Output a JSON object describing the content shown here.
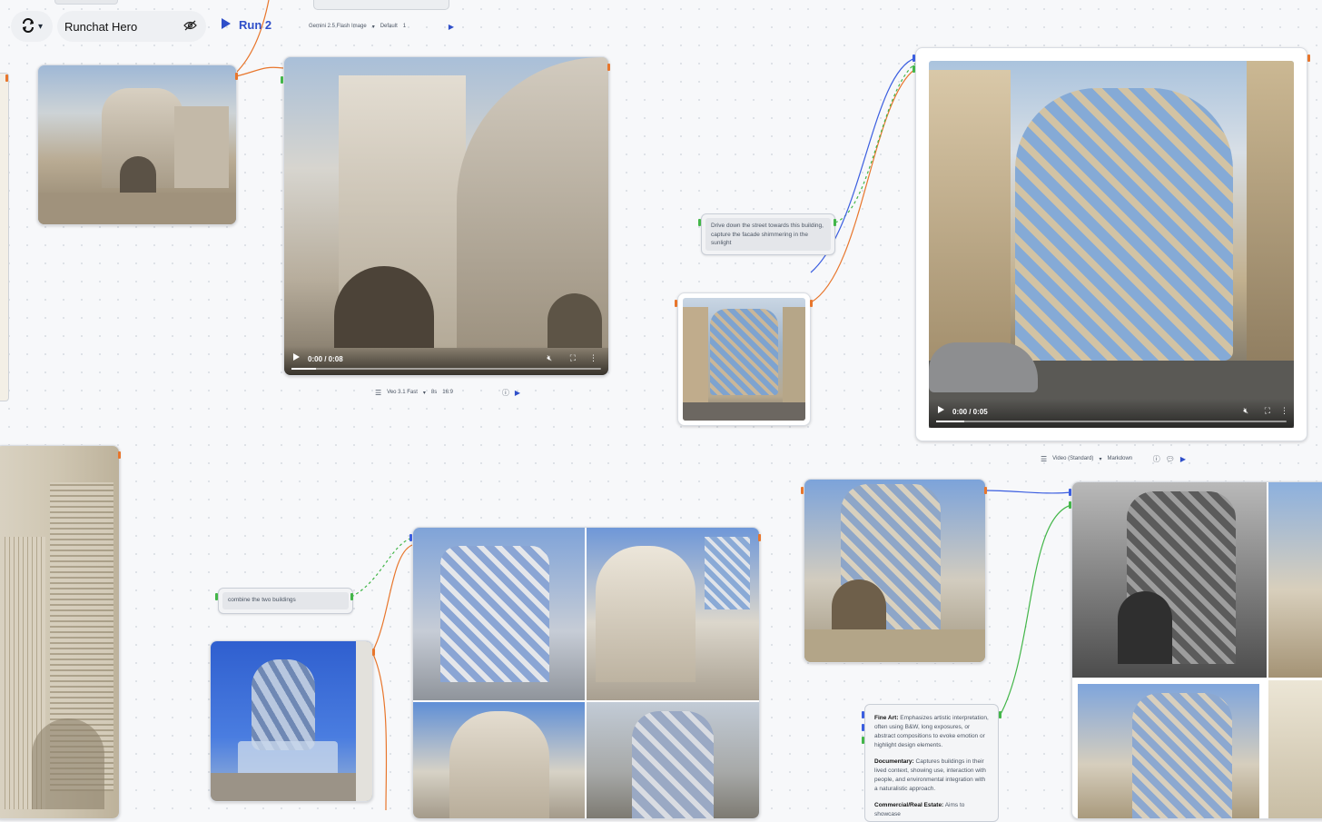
{
  "toolbar": {
    "tool_icon": "rotate-tool-icon",
    "project_name": "Runchat Hero",
    "visibility_icon": "eye-off-icon",
    "run_label": "Run 2"
  },
  "image_params": {
    "model": "Gemini 2.5 Flash Image",
    "preset": "Default",
    "count": "1"
  },
  "video_main": {
    "time": "0:00 / 0:08",
    "params": {
      "model": "Veo 3.1 Fast",
      "duration": "8s",
      "aspect": "16:9"
    }
  },
  "prompt_drive": {
    "text": "Drive down the street towards this building, capture the facade shimmering in the sunlight"
  },
  "video_right": {
    "time": "0:00 / 0:05",
    "params": {
      "model": "Video (Standard)",
      "format": "Markdown"
    }
  },
  "prompt_combine": {
    "text": "combine the two buildings"
  },
  "markdown_node": {
    "items": [
      {
        "title": "Fine Art:",
        "body": "Emphasizes artistic interpretation, often using B&W, long exposures, or abstract compositions to evoke emotion or highlight design elements."
      },
      {
        "title": "Documentary:",
        "body": "Captures buildings in their lived context, showing use, interaction with people, and environmental integration with a naturalistic approach."
      },
      {
        "title": "Commercial/Real Estate:",
        "body": "Aims to showcase"
      }
    ]
  },
  "colors": {
    "accent": "#2f4fc9",
    "port_output": "#e8762c",
    "port_input": "#43b649",
    "port_param": "#3b5ee0"
  }
}
